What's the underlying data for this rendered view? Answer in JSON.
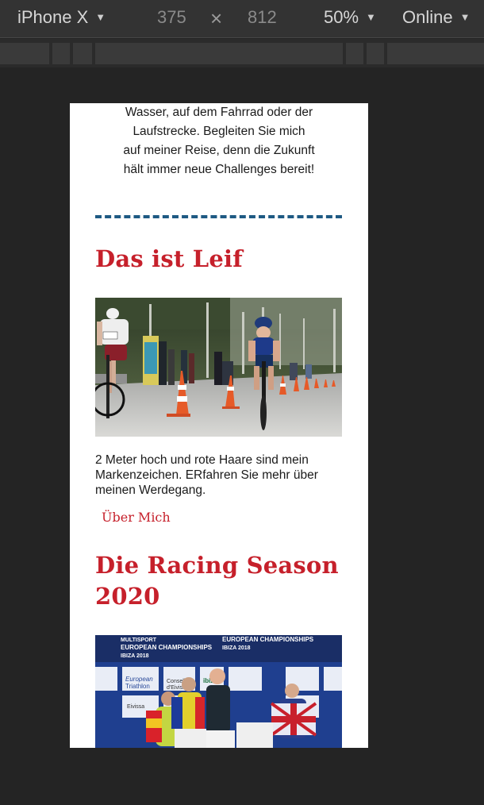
{
  "devtools": {
    "device": "iPhone X",
    "width": "375",
    "times": "×",
    "height": "812",
    "zoom": "50%",
    "network": "Online"
  },
  "page": {
    "intro_lines": [
      "Wasser, auf dem Fahrrad oder der",
      "Laufstrecke. Begleiten Sie mich",
      "auf meiner Reise, denn die Zukunft",
      "hält immer neue Challenges bereit!"
    ],
    "section1_title": "Das ist Leif",
    "bio_lines": [
      "2 Meter hoch und rote Haare sind mein",
      "Markenzeichen. ERfahren Sie mehr über",
      "meinen Werdegang."
    ],
    "about_link": "Über Mich",
    "section2_title_lines": [
      "Die Racing Season",
      "2020"
    ],
    "photo2_banner": "MULTISPORT\nEUROPEAN CHAMPIONSHIPS\nIBIZA 2018",
    "photo2_tags": [
      "European Triathlon",
      "Consell d'Eivissa",
      "ibiza",
      "Eivissa"
    ]
  },
  "colors": {
    "heading": "#c6202b",
    "divider": "#1e5a83",
    "devtools_bg": "#333333",
    "canvas_bg": "#242424"
  }
}
